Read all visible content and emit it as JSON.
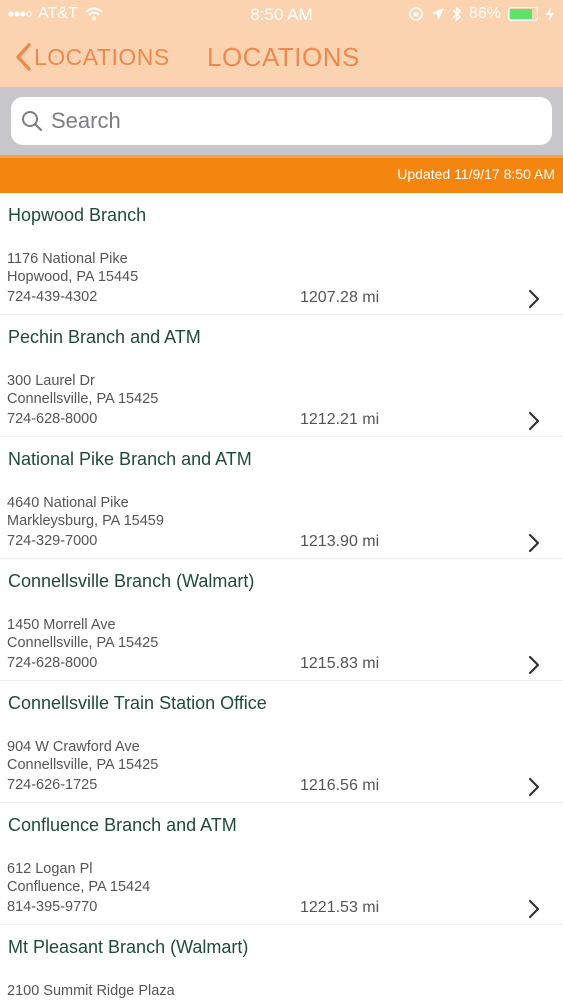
{
  "status_bar": {
    "carrier": "AT&T",
    "time": "8:50 AM",
    "battery_percent": "86%",
    "battery_level": 0.86,
    "icons": [
      "signal-icon",
      "wifi-icon",
      "lock-rotation-icon",
      "location-arrow-icon",
      "bluetooth-icon",
      "battery-icon",
      "charging-icon"
    ]
  },
  "nav": {
    "back_label": "LOCATIONS",
    "title": "LOCATIONS"
  },
  "search": {
    "placeholder": "Search",
    "value": ""
  },
  "updated": {
    "text": "Updated 11/9/17 8:50 AM"
  },
  "locations": [
    {
      "name": "Hopwood Branch",
      "street": "1176 National Pike",
      "city": "Hopwood, PA 15445",
      "phone": "724-439-4302",
      "distance": "1207.28 mi"
    },
    {
      "name": "Pechin Branch and ATM",
      "street": "300 Laurel Dr",
      "city": "Connellsville, PA 15425",
      "phone": "724-628-8000",
      "distance": "1212.21 mi"
    },
    {
      "name": "National Pike Branch and ATM",
      "street": "4640 National Pike",
      "city": "Markleysburg, PA 15459",
      "phone": "724-329-7000",
      "distance": "1213.90 mi"
    },
    {
      "name": "Connellsville Branch (Walmart)",
      "street": "1450 Morrell Ave",
      "city": "Connellsville, PA 15425",
      "phone": "724-628-8000",
      "distance": "1215.83 mi"
    },
    {
      "name": "Connellsville Train Station Office",
      "street": "904 W Crawford Ave",
      "city": "Connellsville, PA 15425",
      "phone": "724-626-1725",
      "distance": "1216.56 mi"
    },
    {
      "name": "Confluence Branch and ATM",
      "street": "612 Logan Pl",
      "city": "Confluence, PA 15424",
      "phone": "814-395-9770",
      "distance": "1221.53 mi"
    },
    {
      "name": "Mt Pleasant Branch (Walmart)",
      "street": "2100 Summit Ridge Plaza",
      "city": "",
      "phone": "",
      "distance": ""
    }
  ],
  "colors": {
    "header_bg": "#fcd3b1",
    "accent": "#ec8a4b",
    "updated_bar": "#f4860f",
    "name_text": "#1f4b3b",
    "battery_fill": "#5ee36a"
  }
}
